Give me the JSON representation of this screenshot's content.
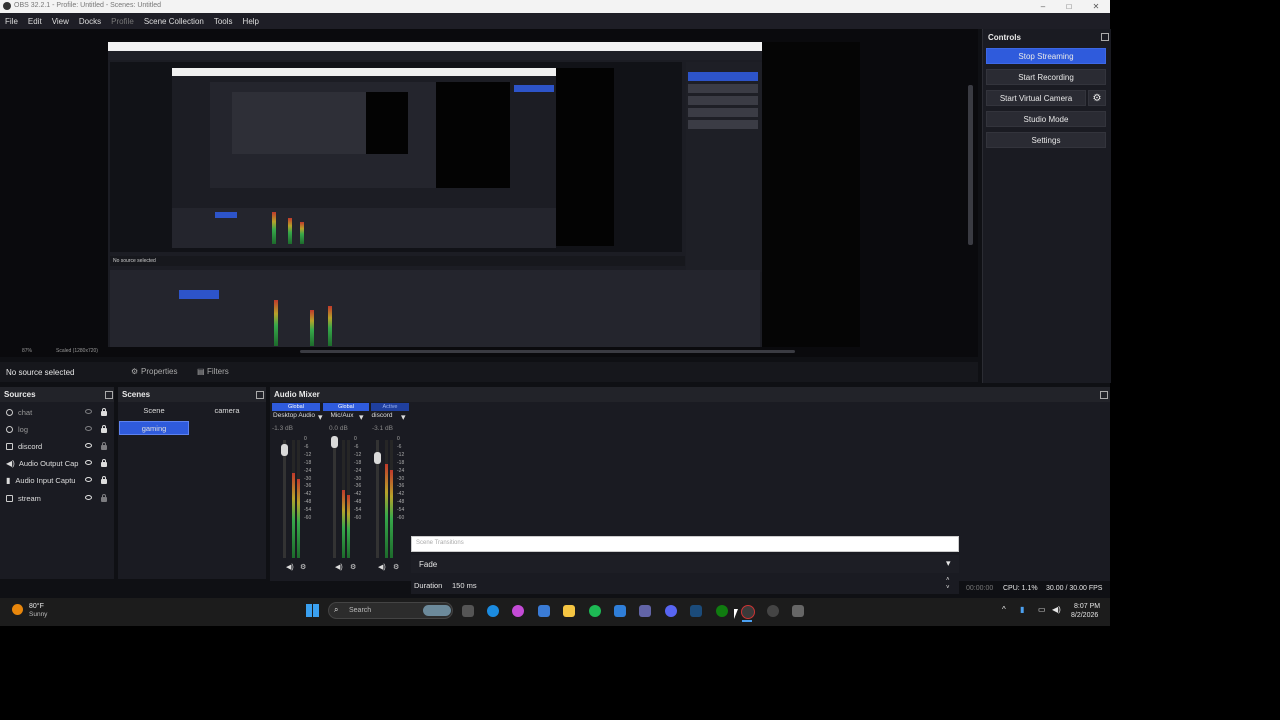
{
  "window": {
    "title": "OBS 32.2.1 - Profile: Untitled - Scenes: Untitled",
    "min": "–",
    "max": "□",
    "close": "✕"
  },
  "menu": [
    "File",
    "Edit",
    "View",
    "Docks",
    "Profile",
    "Scene Collection",
    "Tools",
    "Help"
  ],
  "controls": {
    "title": "Controls",
    "stop_streaming": "Stop Streaming",
    "start_recording": "Start Recording",
    "start_virtual_camera": "Start Virtual Camera",
    "studio_mode": "Studio Mode",
    "settings": "Settings"
  },
  "context": {
    "no_source": "No source selected",
    "properties": "Properties",
    "filters": "Filters"
  },
  "sources": {
    "title": "Sources",
    "items": [
      {
        "name": "chat",
        "icon": "browser-icon"
      },
      {
        "name": "log",
        "icon": "browser-icon"
      },
      {
        "name": "discord",
        "icon": "window-icon"
      },
      {
        "name": "Audio Output Cap",
        "icon": "speaker-icon"
      },
      {
        "name": "Audio Input Captu",
        "icon": "mic-icon"
      },
      {
        "name": "stream",
        "icon": "display-icon"
      }
    ]
  },
  "scenes": {
    "title": "Scenes",
    "items": [
      "Scene",
      "camera",
      "gaming"
    ],
    "selected": "gaming"
  },
  "mixer": {
    "title": "Audio Mixer",
    "channels": [
      {
        "tag": "Global",
        "name": "Desktop Audio",
        "db": "-1.3 dB",
        "level": 0.72
      },
      {
        "tag": "Global",
        "name": "Mic/Aux",
        "db": "0.0 dB",
        "level": 0.58
      },
      {
        "tag": "Active",
        "name": "discord",
        "db": "-3.1 dB",
        "level": 0.8
      }
    ],
    "scale": [
      "0",
      "-6",
      "-12",
      "-18",
      "-24",
      "-30",
      "-36",
      "-42",
      "-48",
      "-54",
      "-60"
    ]
  },
  "transitions": {
    "title": "Scene Transitions",
    "selected": "Fade",
    "duration_label": "Duration",
    "duration_value": "150 ms"
  },
  "status": {
    "time": "00:00:00",
    "cpu": "CPU: 1.1%",
    "fps": "30.00 / 30.00 FPS"
  },
  "nested_preview": {
    "status_left": "No source selected",
    "zoom": "87%",
    "scale": "Scaled (1280x720)"
  },
  "taskbar": {
    "weather_temp": "80°F",
    "weather_desc": "Sunny",
    "search_placeholder": "Search",
    "time": "8:07 PM",
    "date": "8/2/2026"
  },
  "colors": {
    "accent": "#2f5bdc",
    "panel": "#1a1b22",
    "background": "#0f1014"
  }
}
